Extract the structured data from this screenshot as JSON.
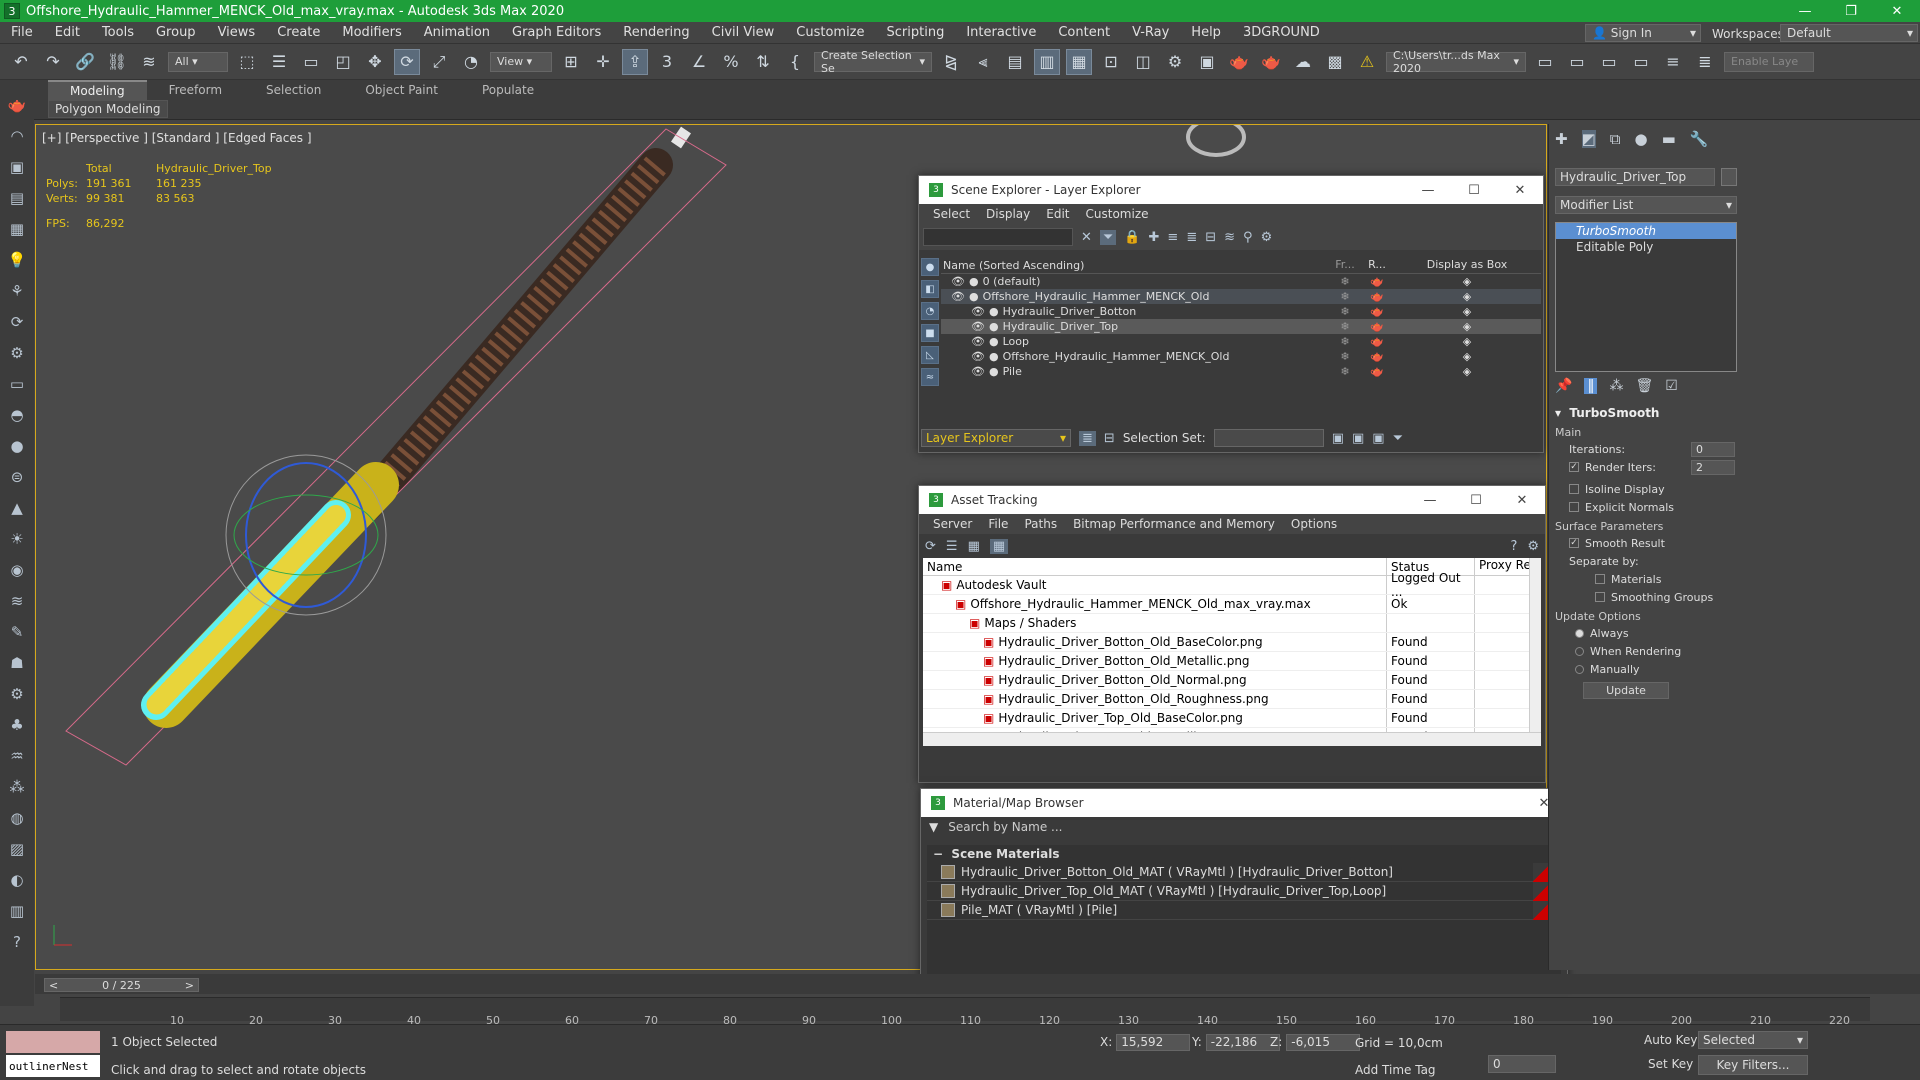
{
  "window": {
    "title": "Offshore_Hydraulic_Hammer_MENCK_Old_max_vray.max - Autodesk 3ds Max 2020"
  },
  "menu": [
    "File",
    "Edit",
    "Tools",
    "Group",
    "Views",
    "Create",
    "Modifiers",
    "Animation",
    "Graph Editors",
    "Rendering",
    "Civil View",
    "Customize",
    "Scripting",
    "Interactive",
    "Content",
    "V-Ray",
    "Help",
    "3DGROUND"
  ],
  "account": {
    "signin": "Sign In",
    "workspaces_label": "Workspaces:",
    "workspace": "Default"
  },
  "toolbar": {
    "filter": "All",
    "view": "View",
    "selection_set": "Create Selection Se",
    "path": "C:\\Users\\tr...ds Max 2020",
    "enable_layer": "Enable Laye"
  },
  "ribbon": {
    "tabs": [
      "Modeling",
      "Freeform",
      "Selection",
      "Object Paint",
      "Populate"
    ],
    "sub": "Polygon Modeling"
  },
  "viewport": {
    "label": "[+] [Perspective ] [Standard ] [Edged Faces ]",
    "stats": {
      "h1": "Total",
      "h2": "Hydraulic_Driver_Top",
      "polys_label": "Polys:",
      "polys_total": "191 361",
      "polys_obj": "161 235",
      "verts_label": "Verts:",
      "verts_total": "99 381",
      "verts_obj": "83 563",
      "fps_label": "FPS:",
      "fps": "86,292"
    }
  },
  "scene_explorer": {
    "title": "Scene Explorer - Layer Explorer",
    "menu": [
      "Select",
      "Display",
      "Edit",
      "Customize"
    ],
    "headers": {
      "name": "Name (Sorted Ascending)",
      "fr": "Fr...",
      "r": "R...",
      "box": "Display as Box"
    },
    "rows": [
      {
        "name": "0 (default)",
        "indent": 0
      },
      {
        "name": "Offshore_Hydraulic_Hammer_MENCK_Old",
        "indent": 0
      },
      {
        "name": "Hydraulic_Driver_Botton",
        "indent": 1
      },
      {
        "name": "Hydraulic_Driver_Top",
        "indent": 1
      },
      {
        "name": "Loop",
        "indent": 1
      },
      {
        "name": "Offshore_Hydraulic_Hammer_MENCK_Old",
        "indent": 1
      },
      {
        "name": "Pile",
        "indent": 1
      }
    ],
    "bottom": {
      "explorer": "Layer Explorer",
      "selection_set_label": "Selection Set:"
    }
  },
  "asset_tracking": {
    "title": "Asset Tracking",
    "menu": [
      "Server",
      "File",
      "Paths",
      "Bitmap Performance and Memory",
      "Options"
    ],
    "headers": {
      "name": "Name",
      "status": "Status",
      "proxy": "Proxy Re"
    },
    "rows": [
      {
        "name": "Autodesk Vault",
        "status": "Logged Out ...",
        "indent": 1
      },
      {
        "name": "Offshore_Hydraulic_Hammer_MENCK_Old_max_vray.max",
        "status": "Ok",
        "indent": 2
      },
      {
        "name": "Maps / Shaders",
        "status": "",
        "indent": 3
      },
      {
        "name": "Hydraulic_Driver_Botton_Old_BaseColor.png",
        "status": "Found",
        "indent": 4
      },
      {
        "name": "Hydraulic_Driver_Botton_Old_Metallic.png",
        "status": "Found",
        "indent": 4
      },
      {
        "name": "Hydraulic_Driver_Botton_Old_Normal.png",
        "status": "Found",
        "indent": 4
      },
      {
        "name": "Hydraulic_Driver_Botton_Old_Roughness.png",
        "status": "Found",
        "indent": 4
      },
      {
        "name": "Hydraulic_Driver_Top_Old_BaseColor.png",
        "status": "Found",
        "indent": 4
      },
      {
        "name": "Hydraulic_Driver_Top_Old_Metallic.png",
        "status": "Found",
        "indent": 4
      }
    ]
  },
  "material_browser": {
    "title": "Material/Map Browser",
    "search": "Search by Name ...",
    "group": "Scene Materials",
    "items": [
      "Hydraulic_Driver_Botton_Old_MAT ( VRayMtl ) [Hydraulic_Driver_Botton]",
      "Hydraulic_Driver_Top_Old_MAT ( VRayMtl ) [Hydraulic_Driver_Top,Loop]",
      "Pile_MAT ( VRayMtl ) [Pile]"
    ]
  },
  "command_panel": {
    "object_name": "Hydraulic_Driver_Top",
    "modifier_list": "Modifier List",
    "stack": [
      "TurboSmooth",
      "Editable Poly"
    ],
    "turbosmooth": {
      "title": "TurboSmooth",
      "main": "Main",
      "iterations_label": "Iterations:",
      "iterations": "0",
      "render_iters_label": "Render Iters:",
      "render_iters": "2",
      "isoline": "Isoline Display",
      "explicit": "Explicit Normals",
      "surface": "Surface Parameters",
      "smooth_result": "Smooth Result",
      "separate_by": "Separate by:",
      "materials": "Materials",
      "smoothing_groups": "Smoothing Groups",
      "update_options": "Update Options",
      "always": "Always",
      "when_rendering": "When Rendering",
      "manually": "Manually",
      "update": "Update"
    }
  },
  "timeline": {
    "frame": "0 / 225",
    "ticks": [
      "10",
      "20",
      "30",
      "40",
      "50",
      "60",
      "70",
      "80",
      "90",
      "100",
      "110",
      "120",
      "130",
      "140",
      "150",
      "160",
      "170",
      "180",
      "190",
      "200",
      "210",
      "220"
    ]
  },
  "status": {
    "outliner": "outlinerNest",
    "selected": "1 Object Selected",
    "hint": "Click and drag to select and rotate objects",
    "x_label": "X:",
    "x": "15,592",
    "y_label": "Y:",
    "y": "-22,186",
    "z_label": "Z:",
    "z": "-6,015",
    "grid": "Grid = 10,0cm",
    "add_time_tag": "Add Time Tag",
    "auto_key": "Auto Key",
    "set_key": "Set Key",
    "selected_dd": "Selected",
    "key_filters": "Key Filters...",
    "frame_num": "0"
  }
}
